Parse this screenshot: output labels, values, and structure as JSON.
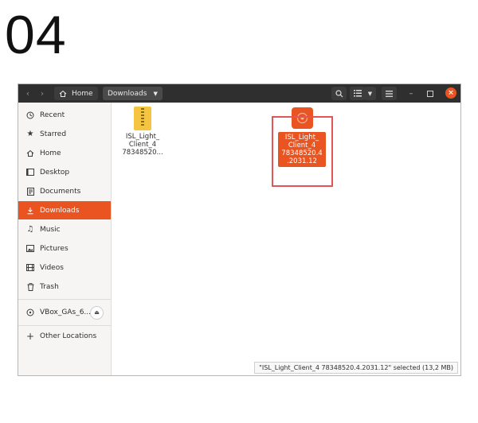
{
  "step_number": "04",
  "titlebar": {
    "crumbs": [
      {
        "label": "Home",
        "icon": "home-icon"
      },
      {
        "label": "Downloads",
        "icon": "chevron-down-icon"
      }
    ],
    "buttons": [
      "search-icon",
      "list-view-icon",
      "view-options-icon",
      "menu-icon",
      "minimize-icon",
      "maximize-icon",
      "close-icon"
    ]
  },
  "sidebar": {
    "items": [
      {
        "label": "Recent",
        "icon": "clock-icon"
      },
      {
        "label": "Starred",
        "icon": "star-icon"
      },
      {
        "label": "Home",
        "icon": "home-icon"
      },
      {
        "label": "Desktop",
        "icon": "desktop-icon"
      },
      {
        "label": "Documents",
        "icon": "document-icon"
      },
      {
        "label": "Downloads",
        "icon": "download-icon",
        "active": true
      },
      {
        "label": "Music",
        "icon": "music-icon"
      },
      {
        "label": "Pictures",
        "icon": "picture-icon"
      },
      {
        "label": "Videos",
        "icon": "video-icon"
      },
      {
        "label": "Trash",
        "icon": "trash-icon"
      }
    ],
    "device": {
      "label": "VBox_GAs_6....",
      "icon": "disc-icon",
      "action_icon": "eject-icon"
    },
    "other": {
      "label": "Other Locations",
      "icon": "plus-icon"
    }
  },
  "files": [
    {
      "name": "ISL_Light_\nClient_4\n78348520...",
      "type": "zip-archive-icon",
      "selected": false
    },
    {
      "name": "ISL_Light_\nClient_4\n78348520.4\n.2031.12",
      "type": "application-icon",
      "selected": true
    }
  ],
  "statusbar": {
    "text": "\"ISL_Light_Client_4 78348520.4.2031.12\" selected (13,2 MB)"
  },
  "colors": {
    "accent": "#e95420",
    "titlebar": "#2f2f2f",
    "highlight_box": "#e05555",
    "zip": "#f5c542"
  }
}
